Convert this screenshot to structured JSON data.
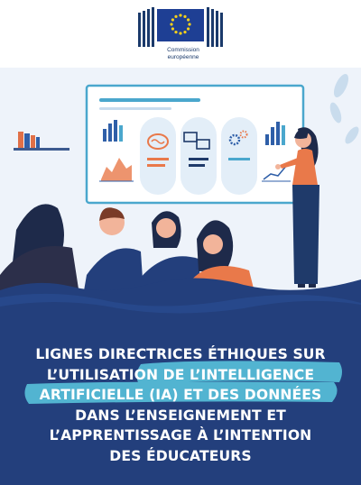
{
  "header": {
    "logo_alt": "Commission européenne logo",
    "logo_line1": "Commission",
    "logo_line2": "européenne"
  },
  "title_lines": [
    "LIGNES DIRECTRICES ÉTHIQUES SUR",
    "L’UTILISATION DE L’INTELLIGENCE",
    "ARTIFICIELLE (IA) ET DES DONNÉES",
    "DANS L’ENSEIGNEMENT ET",
    "L’APPRENTISSAGE À L’INTENTION",
    "DES ÉDUCATEURS"
  ],
  "colors": {
    "navy": "#233f7c",
    "highlight": "#52b4d1",
    "orange": "#e9794a",
    "blue": "#2f5fa8",
    "background": "#eef3fa"
  }
}
